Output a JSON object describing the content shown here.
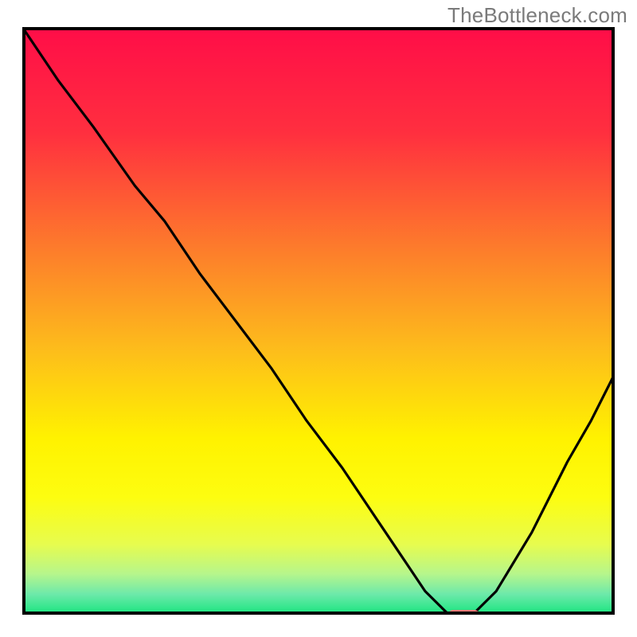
{
  "watermark": {
    "text": "TheBottleneck.com"
  },
  "chart_data": {
    "type": "line",
    "title": "",
    "xlabel": "",
    "ylabel": "",
    "xlim": [
      0,
      100
    ],
    "ylim": [
      0,
      100
    ],
    "grid": false,
    "legend": false,
    "background_gradient": {
      "stops": [
        {
          "pos": 0.0,
          "color": "#ff0d48"
        },
        {
          "pos": 0.18,
          "color": "#ff2f3f"
        },
        {
          "pos": 0.38,
          "color": "#fd7d2b"
        },
        {
          "pos": 0.55,
          "color": "#fdbd1b"
        },
        {
          "pos": 0.7,
          "color": "#fff200"
        },
        {
          "pos": 0.8,
          "color": "#fdfd10"
        },
        {
          "pos": 0.88,
          "color": "#e7fc4e"
        },
        {
          "pos": 0.93,
          "color": "#b7f68b"
        },
        {
          "pos": 0.965,
          "color": "#6de9aa"
        },
        {
          "pos": 1.0,
          "color": "#17e57e"
        }
      ]
    },
    "series": [
      {
        "name": "bottleneck-curve",
        "x": [
          0,
          6,
          12,
          19,
          24,
          30,
          36,
          42,
          48,
          54,
          60,
          64,
          68,
          72,
          76,
          80,
          86,
          92,
          96,
          100
        ],
        "y": [
          100,
          91,
          83,
          73,
          67,
          58,
          50,
          42,
          33,
          25,
          16,
          10,
          4,
          0,
          0,
          4,
          14,
          26,
          33,
          41
        ]
      }
    ],
    "marker": {
      "name": "optimal-marker",
      "shape": "pill",
      "color": "#ef7a78",
      "x": 74.5,
      "y": 0,
      "width_pct": 5.2,
      "height_pct": 1.6
    }
  }
}
